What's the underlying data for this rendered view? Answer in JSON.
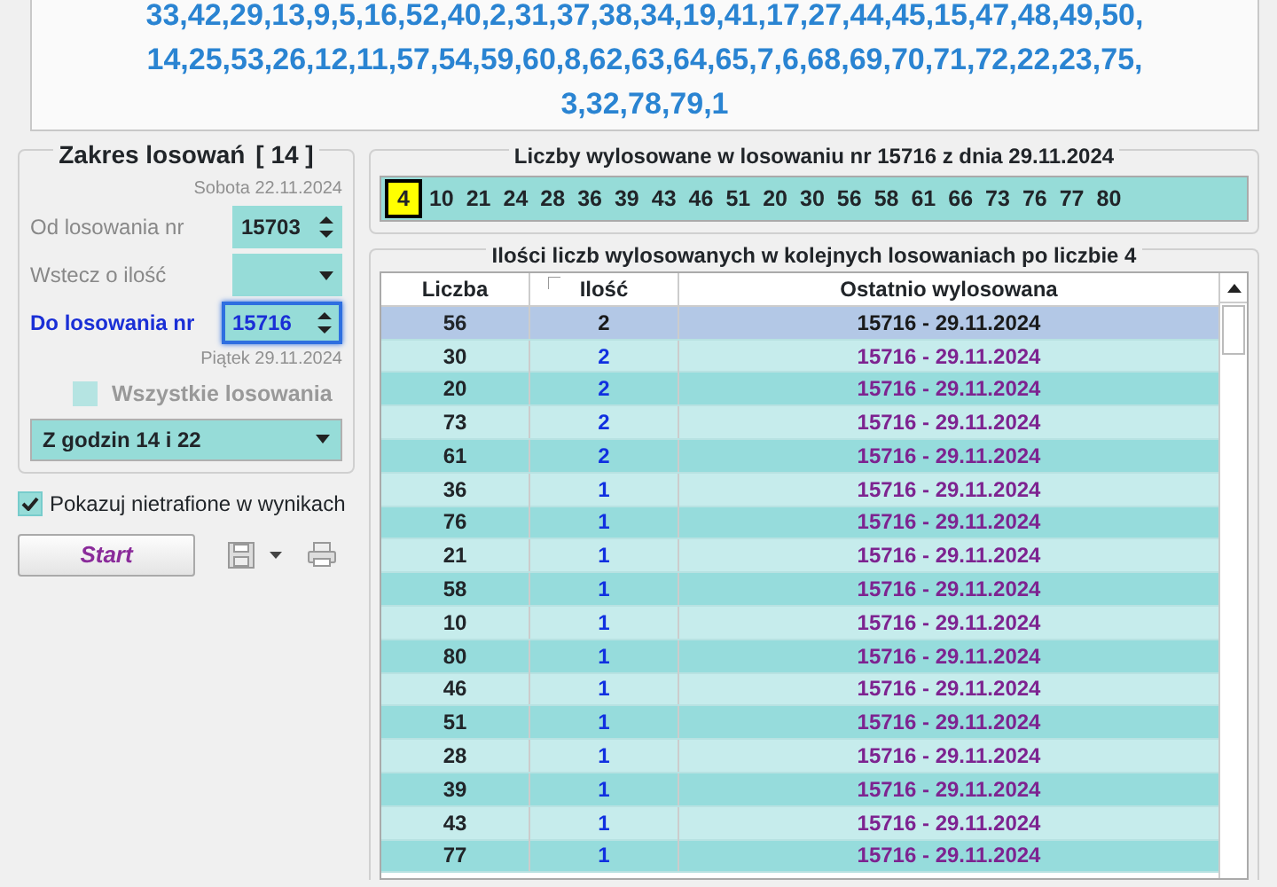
{
  "results_lines": [
    "33,42,29,13,9,5,16,52,40,2,31,37,38,34,19,41,17,27,44,45,15,47,48,49,50,",
    "14,25,53,26,12,11,57,54,59,60,8,62,63,64,65,7,6,68,69,70,71,72,22,23,75,",
    "3,32,78,79,1"
  ],
  "range_panel": {
    "title": "Zakres losowań",
    "count": "[ 14 ]",
    "from_date": "Sobota 22.11.2024",
    "fields": [
      {
        "kind": "spinner",
        "label": "Od losowania nr",
        "value": "15703",
        "selected": false
      },
      {
        "kind": "dropdown",
        "label": "Wstecz o ilość",
        "selected": false
      },
      {
        "kind": "spinner",
        "label": "Do losowania nr",
        "value": "15716",
        "selected": true
      }
    ],
    "to_date": "Piątek 29.11.2024",
    "all_draws": {
      "label": "Wszystkie losowania",
      "checked": false,
      "disabled": true
    },
    "hours_dropdown": "Z godzin 14 i 22"
  },
  "show_missed": {
    "label": "Pokazuj nietrafione w wynikach",
    "checked": true
  },
  "start_button": "Start",
  "drawn_panel": {
    "title": "Liczby wylosowane w losowaniu nr 15716 z dnia 29.11.2024",
    "numbers": [
      {
        "value": "4",
        "selected": true
      },
      {
        "value": "10",
        "selected": false
      },
      {
        "value": "21",
        "selected": false
      },
      {
        "value": "24",
        "selected": false
      },
      {
        "value": "28",
        "selected": false
      },
      {
        "value": "36",
        "selected": false
      },
      {
        "value": "39",
        "selected": false
      },
      {
        "value": "43",
        "selected": false
      },
      {
        "value": "46",
        "selected": false
      },
      {
        "value": "51",
        "selected": false
      },
      {
        "value": "20",
        "selected": false
      },
      {
        "value": "30",
        "selected": false
      },
      {
        "value": "56",
        "selected": false
      },
      {
        "value": "58",
        "selected": false
      },
      {
        "value": "61",
        "selected": false
      },
      {
        "value": "66",
        "selected": false
      },
      {
        "value": "73",
        "selected": false
      },
      {
        "value": "76",
        "selected": false
      },
      {
        "value": "77",
        "selected": false
      },
      {
        "value": "80",
        "selected": false
      }
    ]
  },
  "table": {
    "title": "Ilości liczb wylosowanych w kolejnych losowaniach po liczbie 4",
    "columns": [
      "Liczba",
      "Ilość",
      "Ostatnio wylosowana"
    ],
    "rows": [
      {
        "cells": [
          "56",
          "2",
          "15716 - 29.11.2024"
        ],
        "selected": true
      },
      {
        "cells": [
          "30",
          "2",
          "15716 - 29.11.2024"
        ],
        "selected": false
      },
      {
        "cells": [
          "20",
          "2",
          "15716 - 29.11.2024"
        ],
        "selected": false
      },
      {
        "cells": [
          "73",
          "2",
          "15716 - 29.11.2024"
        ],
        "selected": false
      },
      {
        "cells": [
          "61",
          "2",
          "15716 - 29.11.2024"
        ],
        "selected": false
      },
      {
        "cells": [
          "36",
          "1",
          "15716 - 29.11.2024"
        ],
        "selected": false
      },
      {
        "cells": [
          "76",
          "1",
          "15716 - 29.11.2024"
        ],
        "selected": false
      },
      {
        "cells": [
          "21",
          "1",
          "15716 - 29.11.2024"
        ],
        "selected": false
      },
      {
        "cells": [
          "58",
          "1",
          "15716 - 29.11.2024"
        ],
        "selected": false
      },
      {
        "cells": [
          "10",
          "1",
          "15716 - 29.11.2024"
        ],
        "selected": false
      },
      {
        "cells": [
          "80",
          "1",
          "15716 - 29.11.2024"
        ],
        "selected": false
      },
      {
        "cells": [
          "46",
          "1",
          "15716 - 29.11.2024"
        ],
        "selected": false
      },
      {
        "cells": [
          "51",
          "1",
          "15716 - 29.11.2024"
        ],
        "selected": false
      },
      {
        "cells": [
          "28",
          "1",
          "15716 - 29.11.2024"
        ],
        "selected": false
      },
      {
        "cells": [
          "39",
          "1",
          "15716 - 29.11.2024"
        ],
        "selected": false
      },
      {
        "cells": [
          "43",
          "1",
          "15716 - 29.11.2024"
        ],
        "selected": false
      },
      {
        "cells": [
          "77",
          "1",
          "15716 - 29.11.2024"
        ],
        "selected": false
      }
    ]
  }
}
